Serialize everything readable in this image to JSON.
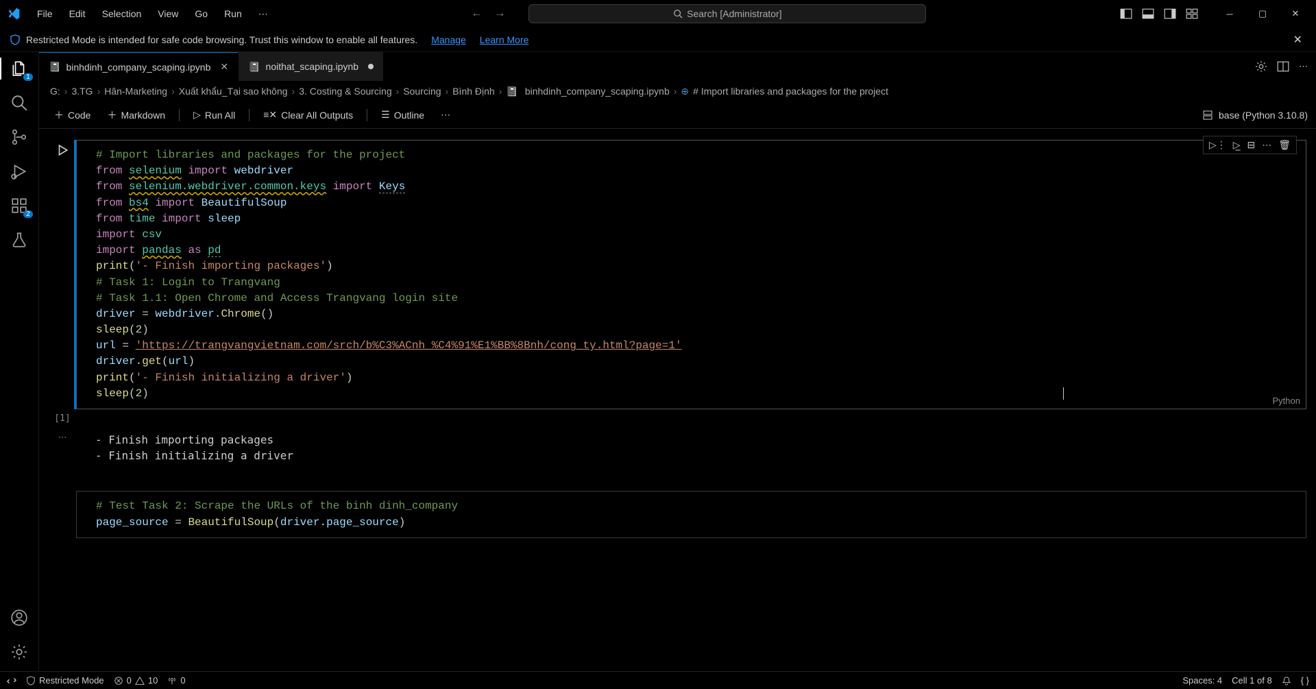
{
  "menu": {
    "file": "File",
    "edit": "Edit",
    "selection": "Selection",
    "view": "View",
    "go": "Go",
    "run": "Run",
    "more": "⋯"
  },
  "search": {
    "placeholder": "Search [Administrator]"
  },
  "notification": {
    "text": "Restricted Mode is intended for safe code browsing. Trust this window to enable all features.",
    "manage": "Manage",
    "learn": "Learn More"
  },
  "activity": {
    "explorer_badge": "1",
    "extensions_badge": "2"
  },
  "tabs": {
    "t1": "binhdinh_company_scaping.ipynb",
    "t2": "noithat_scaping.ipynb"
  },
  "breadcrumb": {
    "b0": "G:",
    "b1": "3.TG",
    "b2": "Hân-Marketing",
    "b3": "Xuất khẩu_Tại sao không",
    "b4": "3. Costing & Sourcing",
    "b5": "Sourcing",
    "b6": "Bình Định",
    "b7": "binhdinh_company_scaping.ipynb",
    "b8": "# Import libraries and packages for the project"
  },
  "nb_toolbar": {
    "code": "Code",
    "markdown": "Markdown",
    "run_all": "Run All",
    "clear": "Clear All Outputs",
    "outline": "Outline",
    "kernel": "base (Python 3.10.8)"
  },
  "cell1": {
    "exec": "[1]",
    "lang": "Python",
    "c1": "# Import libraries and packages for the project",
    "from": "from",
    "import": "import",
    "as": "as",
    "selenium": "selenium",
    "webdriver": "webdriver",
    "selenium_keys": "selenium.webdriver.common.keys",
    "Keys": "Keys",
    "bs4": "bs4",
    "BeautifulSoup": "BeautifulSoup",
    "time": "time",
    "sleep": "sleep",
    "csv": "csv",
    "pandas": "pandas",
    "pd": "pd",
    "print": "print",
    "s1": "'- Finish importing packages'",
    "c2": "# Task 1: Login to Trangvang",
    "c3": "# Task 1.1: Open Chrome and Access Trangvang login site",
    "driver": "driver",
    "Chrome": "Chrome",
    "n2": "2",
    "url": "url",
    "url_val": "'https://trangvangvietnam.com/srch/b%C3%ACnh_%C4%91%E1%BB%8Bnh/cong_ty.html?page=1'",
    "get": "get",
    "s2": "'- Finish initializing a driver'"
  },
  "output1": {
    "l1": "- Finish importing packages",
    "l2": "- Finish initializing a driver"
  },
  "cell2": {
    "c1": "# Test Task 2: Scrape the URLs of the binh dinh_company",
    "page_source": "page_source",
    "BeautifulSoup": "BeautifulSoup",
    "driver": "driver",
    "dot_page_source": "page_source"
  },
  "status": {
    "restricted": "Restricted Mode",
    "errors": "0",
    "warnings": "10",
    "ports": "0",
    "spaces": "Spaces: 4",
    "cell": "Cell 1 of 8"
  }
}
